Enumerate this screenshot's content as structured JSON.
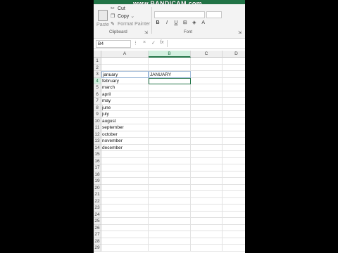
{
  "watermark": "www.BANDICAM.com",
  "ribbon": {
    "paste_label": "Paste",
    "cut_label": "Cut",
    "copy_label": "Copy",
    "format_painter_label": "Format Painter",
    "clipboard_group": "Clipboard",
    "font_group": "Font",
    "bold": "B",
    "italic": "I",
    "underline": "U"
  },
  "formula_bar": {
    "name_box": "B4",
    "cancel": "×",
    "enter": "✓",
    "fx": "fx"
  },
  "columns": [
    "A",
    "B",
    "C",
    "D"
  ],
  "rows": [
    "1",
    "2",
    "3",
    "4",
    "5",
    "6",
    "7",
    "8",
    "9",
    "10",
    "11",
    "12",
    "13",
    "14",
    "15",
    "16",
    "17",
    "18",
    "19",
    "20",
    "21",
    "22",
    "23",
    "24",
    "25",
    "26",
    "27",
    "28",
    "29"
  ],
  "cells": {
    "A3": "january",
    "A4": "february",
    "A5": "march",
    "A6": "april",
    "A7": "may",
    "A8": "june",
    "A9": "july",
    "A10": "august",
    "A11": "september",
    "A12": "october",
    "A13": "november",
    "A14": "december",
    "B3": "JANUARY"
  },
  "colors": {
    "accent": "#217346"
  }
}
